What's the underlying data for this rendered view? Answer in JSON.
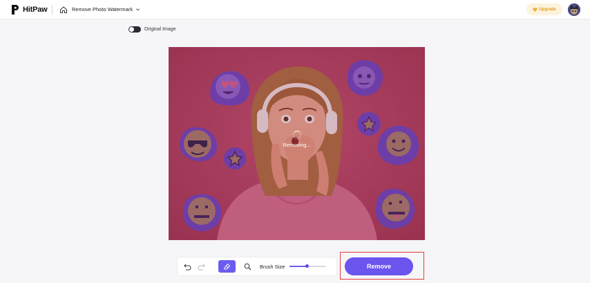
{
  "header": {
    "brand": "HitPaw",
    "tool_name": "Remove Photo Watermark",
    "upgrade_label": "Upgrade"
  },
  "toggle": {
    "label": "Original Image",
    "on": false
  },
  "canvas": {
    "status_text": "Removing..."
  },
  "toolbar": {
    "brush_size_label": "Brush Size",
    "brush_size_percent": 49
  },
  "remove_button": {
    "label": "Remove"
  },
  "colors": {
    "accent": "#6b5cf0",
    "upgrade_text": "#e59d27",
    "highlight_frame": "#e23b3b",
    "overlay_tint": "#b14b6e"
  }
}
